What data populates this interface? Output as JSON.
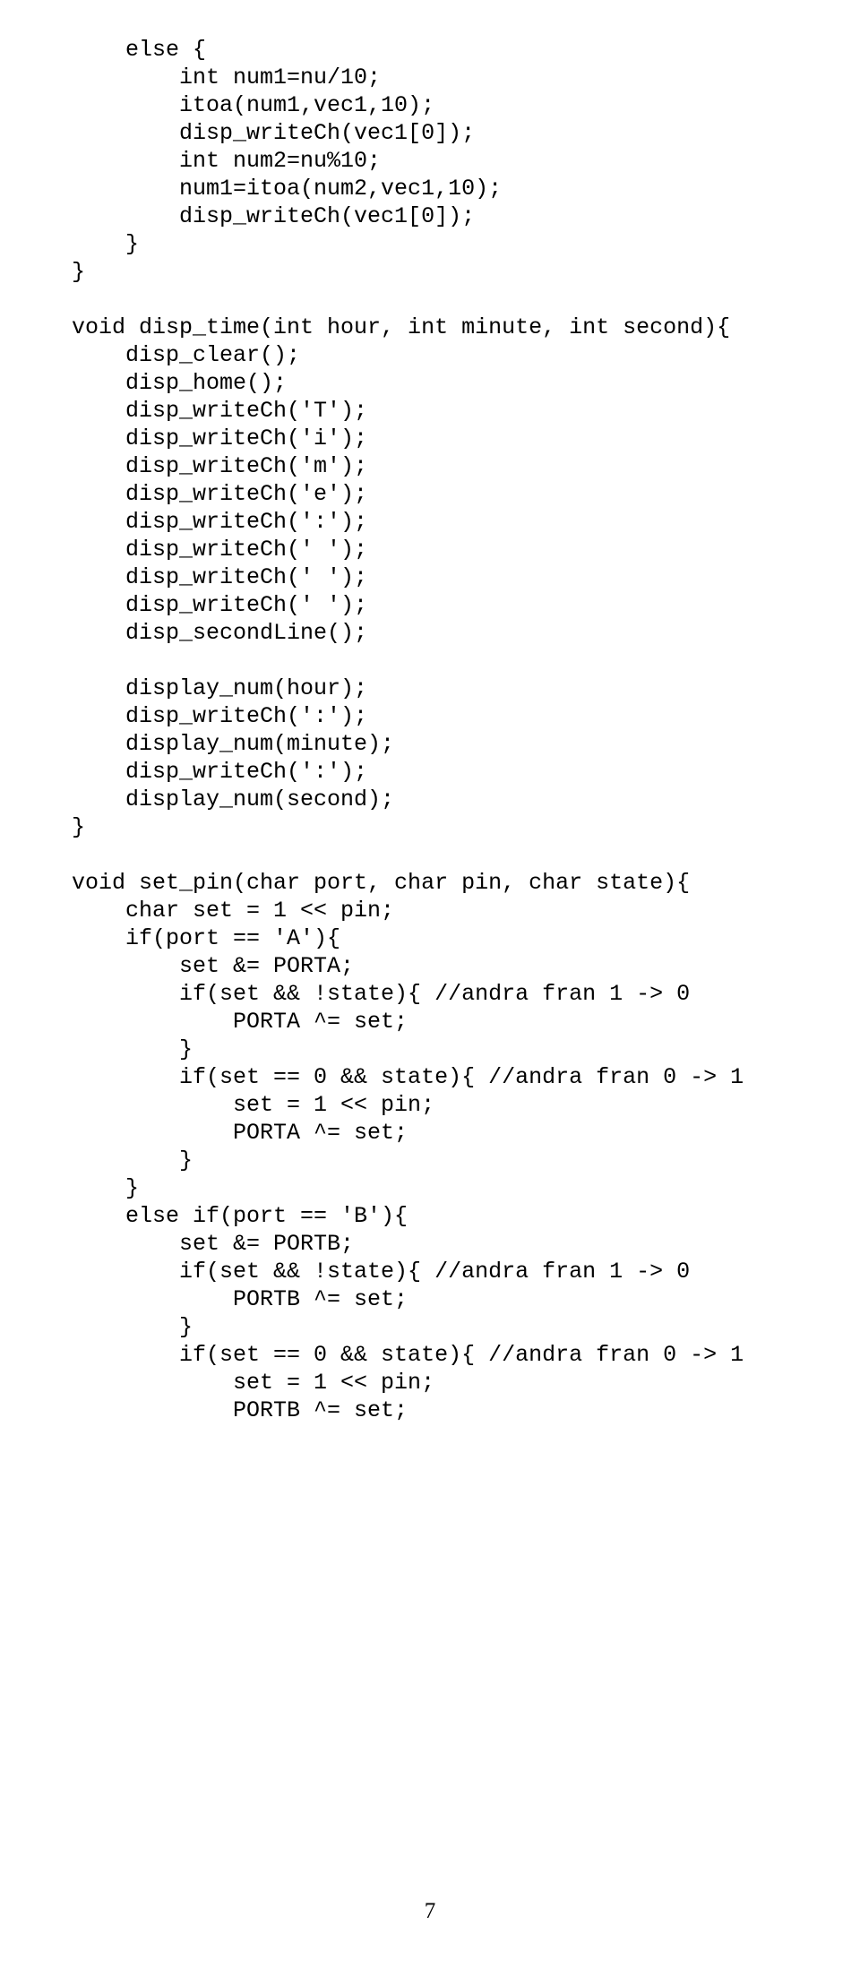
{
  "page_number": "7",
  "code_lines": [
    "    else {",
    "        int num1=nu/10;",
    "        itoa(num1,vec1,10);",
    "        disp_writeCh(vec1[0]);",
    "        int num2=nu%10;",
    "        num1=itoa(num2,vec1,10);",
    "        disp_writeCh(vec1[0]);",
    "    }",
    "}",
    "",
    "void disp_time(int hour, int minute, int second){",
    "    disp_clear();",
    "    disp_home();",
    "    disp_writeCh('T');",
    "    disp_writeCh('i');",
    "    disp_writeCh('m');",
    "    disp_writeCh('e');",
    "    disp_writeCh(':');",
    "    disp_writeCh(' ');",
    "    disp_writeCh(' ');",
    "    disp_writeCh(' ');",
    "    disp_secondLine();",
    "",
    "    display_num(hour);",
    "    disp_writeCh(':');",
    "    display_num(minute);",
    "    disp_writeCh(':');",
    "    display_num(second);",
    "}",
    "",
    "void set_pin(char port, char pin, char state){",
    "    char set = 1 << pin;",
    "    if(port == 'A'){",
    "        set &= PORTA;",
    "        if(set && !state){ //andra fran 1 -> 0",
    "            PORTA ^= set;",
    "        }",
    "        if(set == 0 && state){ //andra fran 0 -> 1",
    "            set = 1 << pin;",
    "            PORTA ^= set;",
    "        }",
    "    }",
    "    else if(port == 'B'){",
    "        set &= PORTB;",
    "        if(set && !state){ //andra fran 1 -> 0",
    "            PORTB ^= set;",
    "        }",
    "        if(set == 0 && state){ //andra fran 0 -> 1",
    "            set = 1 << pin;",
    "            PORTB ^= set;"
  ]
}
